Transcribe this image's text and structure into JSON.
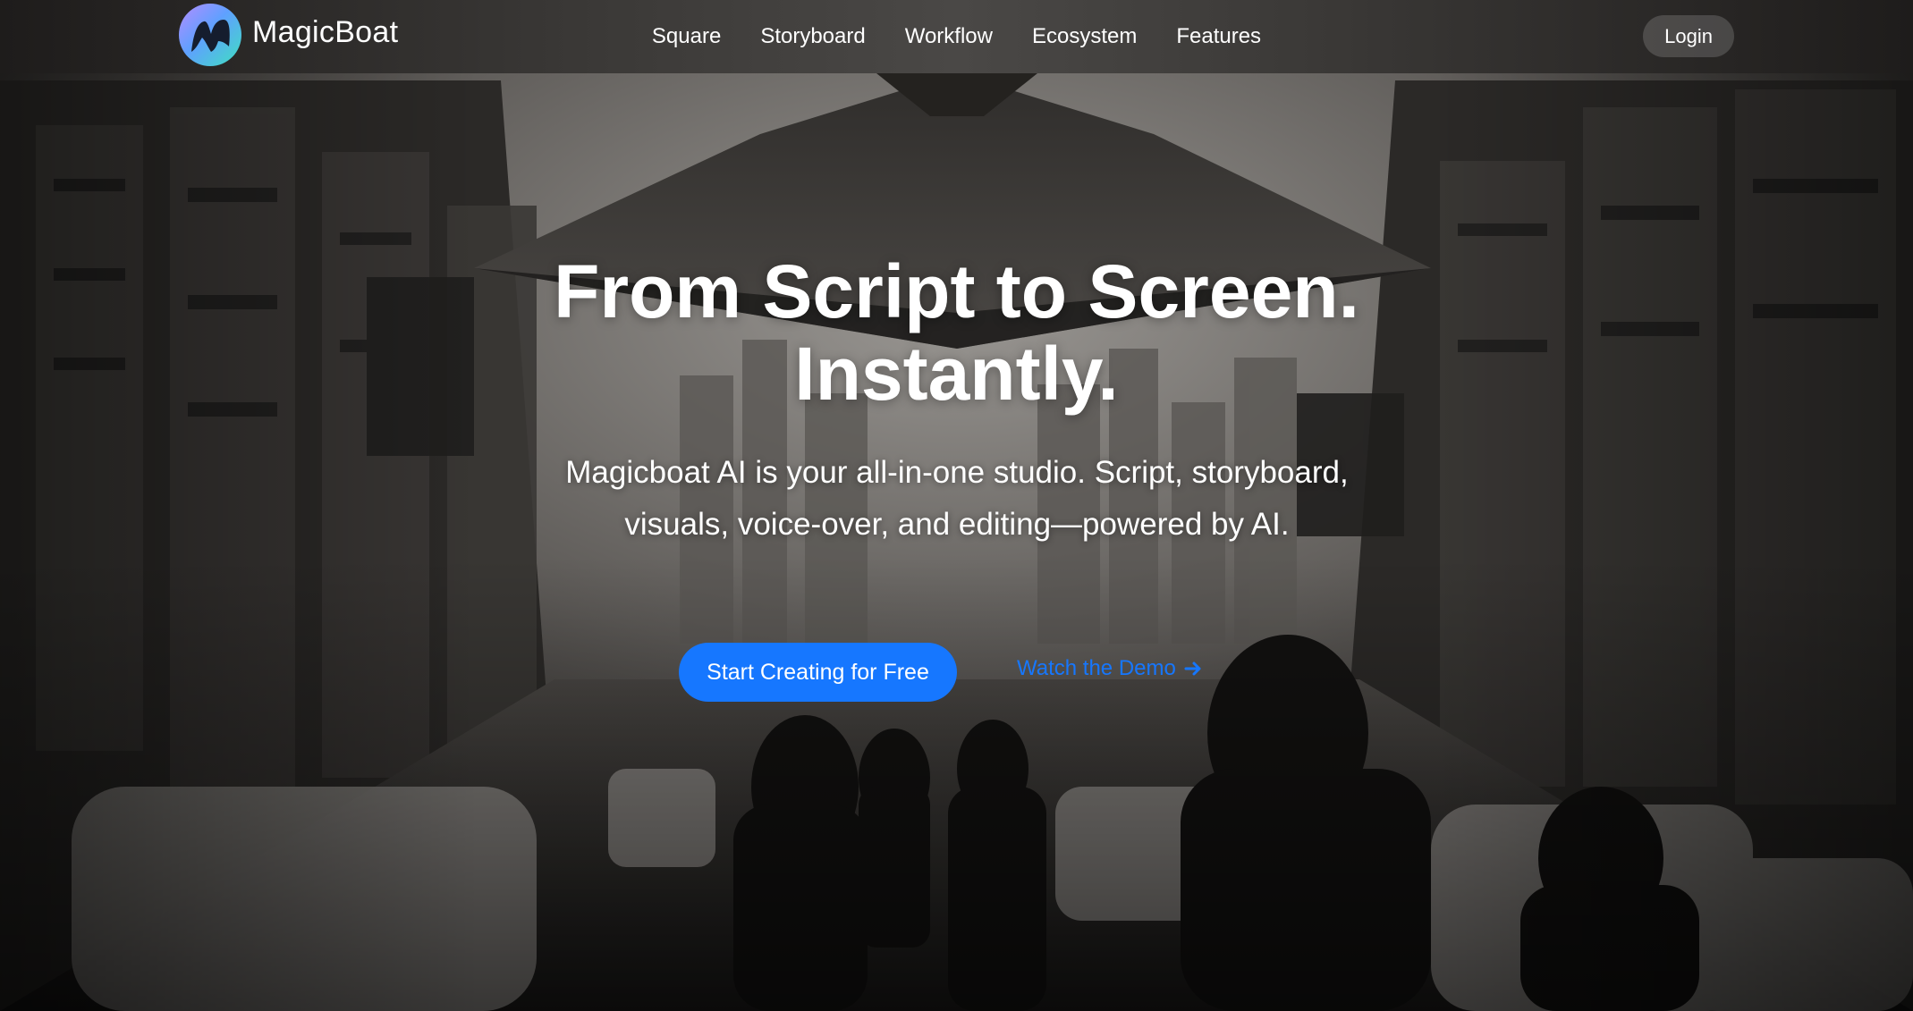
{
  "brand": {
    "name": "MagicBoat",
    "logo_icon": "magicboat-logo-icon"
  },
  "nav": {
    "items": [
      {
        "label": "Square"
      },
      {
        "label": "Storyboard"
      },
      {
        "label": "Workflow"
      },
      {
        "label": "Ecosystem"
      },
      {
        "label": "Features"
      }
    ],
    "login_label": "Login"
  },
  "hero": {
    "title_line1": "From Script to Screen.",
    "title_line2": "Instantly.",
    "subtitle": "Magicboat AI is your all-in-one studio. Script, storyboard, visuals, voice-over, and editing—powered by AI.",
    "primary_cta": "Start Creating for Free",
    "secondary_cta": "Watch the Demo",
    "secondary_cta_icon": "arrow-right-icon"
  },
  "colors": {
    "accent": "#1677ff",
    "nav_bg": "#2e2c2a",
    "text": "#ffffff"
  }
}
